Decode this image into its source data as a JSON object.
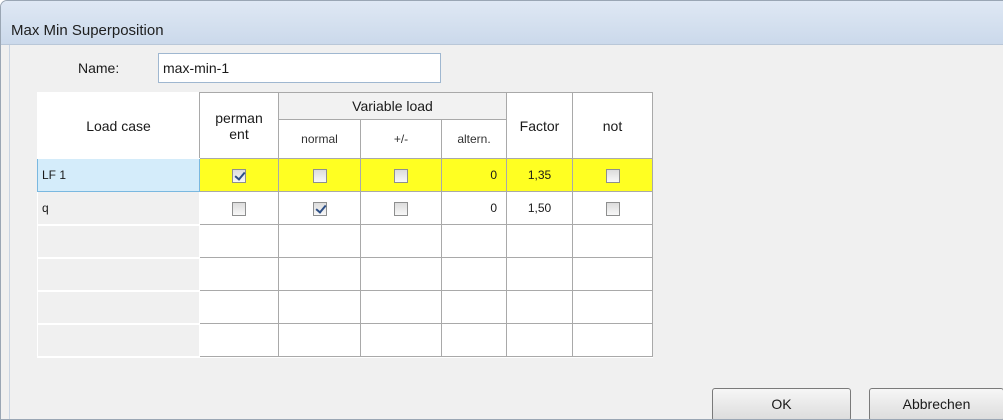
{
  "window": {
    "title": "Max Min Superposition"
  },
  "name_field": {
    "label": "Name:",
    "value": "max-min-1"
  },
  "table": {
    "headers": {
      "load_case": "Load case",
      "permanent_line1": "perman",
      "permanent_line2": "ent",
      "variable_load": "Variable load",
      "normal": "normal",
      "plus_minus": "+/-",
      "altern": "altern.",
      "factor": "Factor",
      "not": "not"
    },
    "rows": [
      {
        "load_case": "LF 1",
        "permanent": true,
        "normal": false,
        "plus_minus": false,
        "altern": "0",
        "factor": "1,35",
        "not": false,
        "highlighted": true
      },
      {
        "load_case": "q",
        "permanent": false,
        "normal": true,
        "plus_minus": false,
        "altern": "0",
        "factor": "1,50",
        "not": false,
        "highlighted": false
      }
    ],
    "empty_row_count": 4,
    "highlight_color": "#ffff22"
  },
  "buttons": {
    "ok": "OK",
    "cancel": "Abbrechen"
  }
}
